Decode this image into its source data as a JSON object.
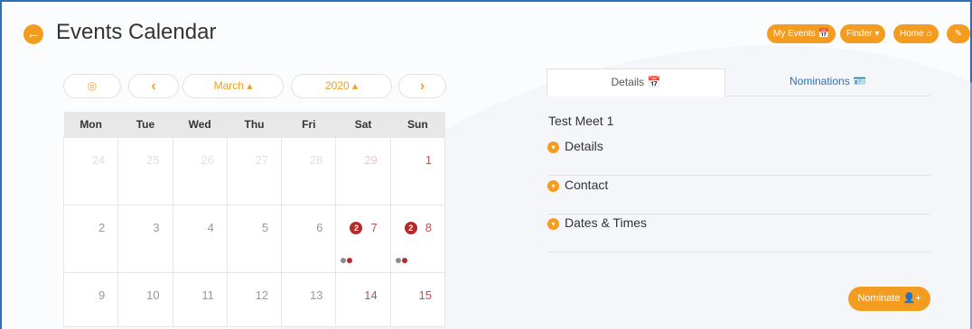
{
  "header": {
    "back_icon": "←",
    "title": "Events Calendar",
    "buttons": [
      {
        "label": "My Events",
        "icon": "📅"
      },
      {
        "label": "Finder",
        "icon": "▾"
      },
      {
        "label": "Home",
        "icon": "⌂"
      },
      {
        "label": "",
        "icon": "✎"
      }
    ]
  },
  "calendar_nav": {
    "today_icon": "◎",
    "prev_icon": "‹",
    "month": "March ▴",
    "year": "2020 ▴",
    "next_icon": "›"
  },
  "calendar": {
    "weekdays": [
      "Mon",
      "Tue",
      "Wed",
      "Thu",
      "Fri",
      "Sat",
      "Sun"
    ],
    "weeks": [
      [
        "24",
        "25",
        "26",
        "27",
        "28",
        "29",
        "1"
      ],
      [
        "2",
        "3",
        "4",
        "5",
        "6",
        "7",
        "8"
      ],
      [
        "9",
        "10",
        "11",
        "12",
        "13",
        "14",
        "15"
      ]
    ],
    "badges": {
      "sat": "2",
      "sun": "2"
    },
    "dot_colors": [
      "#8c8c8c",
      "#b52a2a"
    ]
  },
  "detail": {
    "tabs": [
      {
        "label": "Details",
        "icon": "📅"
      },
      {
        "label": "Nominations",
        "icon": "🪪"
      }
    ],
    "meet_name": "Test Meet 1",
    "sections": [
      "Details",
      "Contact",
      "Dates & Times"
    ],
    "chevron_icon": "▾",
    "nominate_label": "Nominate",
    "nominate_icon": "👤+"
  },
  "colors": {
    "accent": "#f39c1f",
    "link": "#2d6fb7",
    "badge": "#b52a2a"
  }
}
